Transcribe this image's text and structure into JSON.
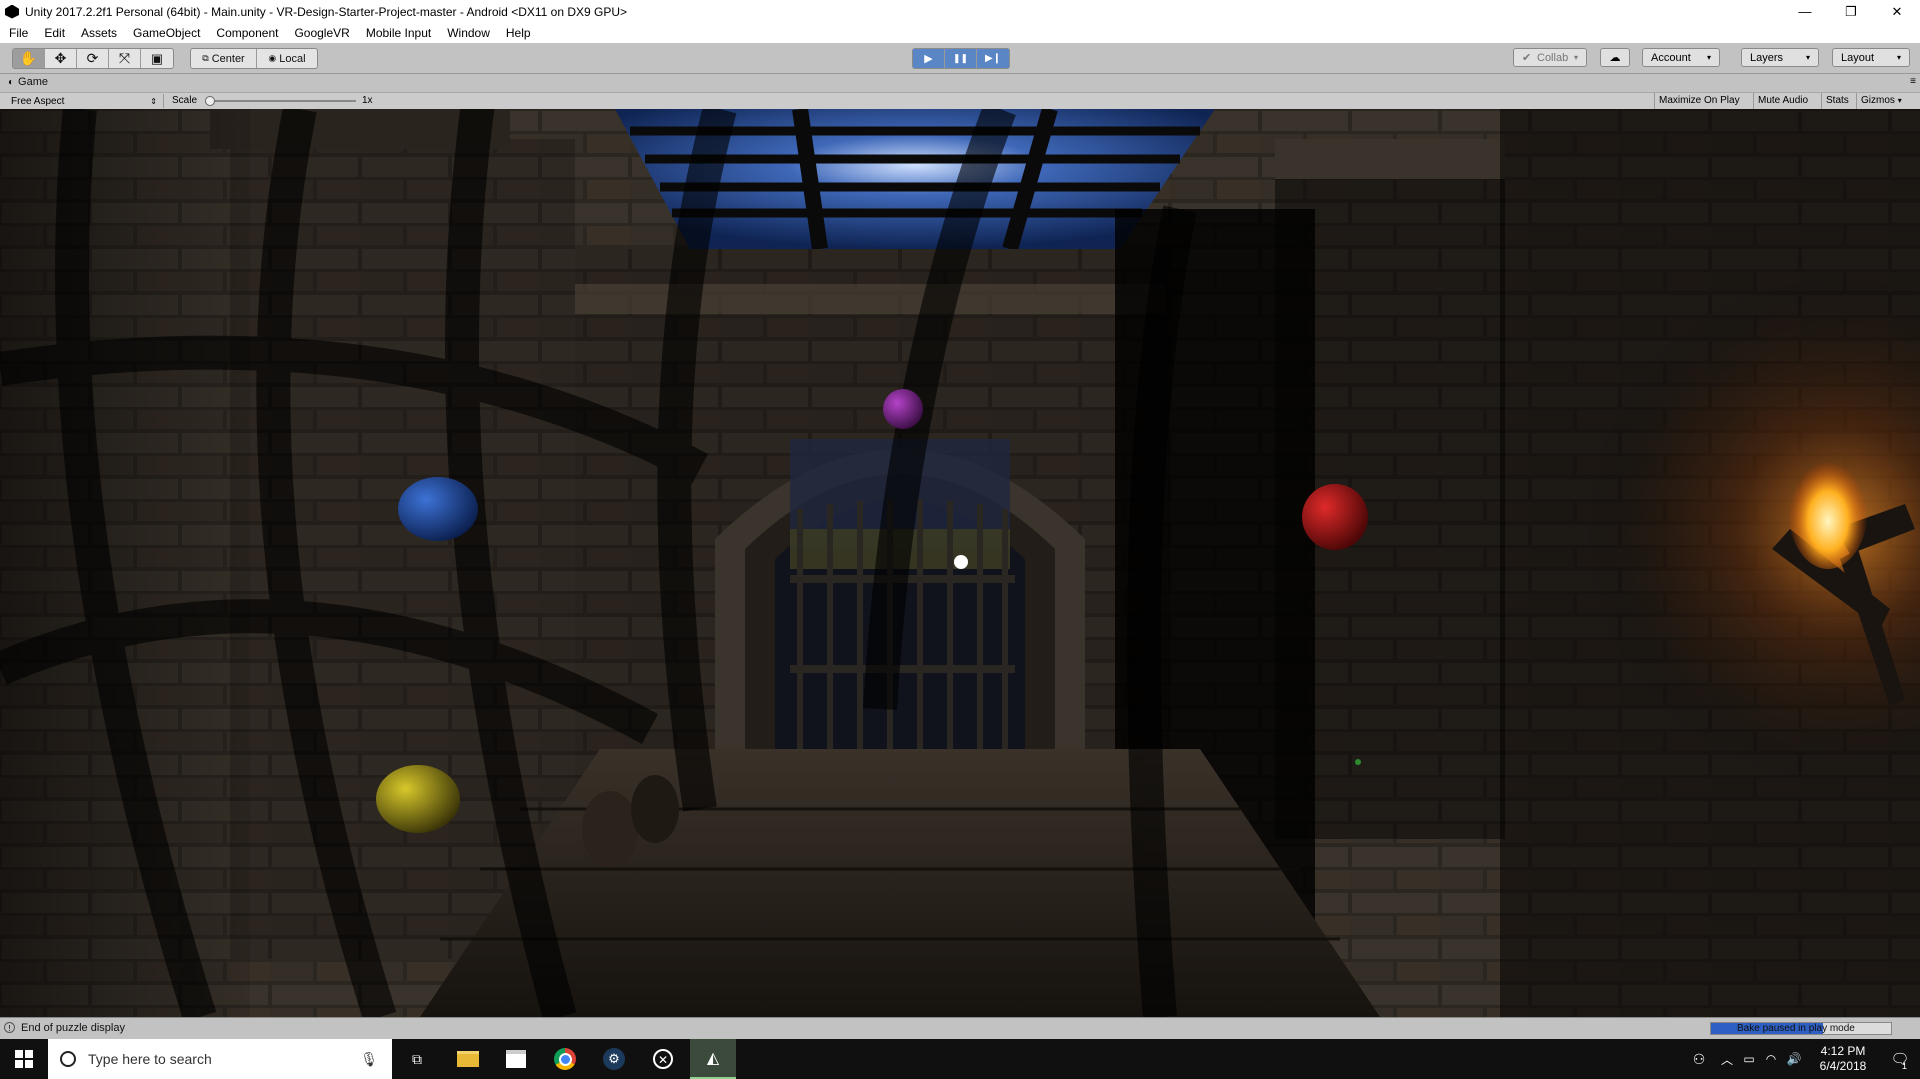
{
  "window": {
    "title": "Unity 2017.2.2f1 Personal (64bit) - Main.unity - VR-Design-Starter-Project-master - Android <DX11 on DX9 GPU>",
    "controls": [
      "—",
      "❐",
      "✕"
    ]
  },
  "menu": [
    "File",
    "Edit",
    "Assets",
    "GameObject",
    "Component",
    "GoogleVR",
    "Mobile Input",
    "Window",
    "Help"
  ],
  "toolbar": {
    "tools": [
      {
        "name": "hand-tool",
        "icon": "✋"
      },
      {
        "name": "move-tool",
        "icon": "✥"
      },
      {
        "name": "rotate-tool",
        "icon": "⟳"
      },
      {
        "name": "scale-tool",
        "icon": "⤧"
      },
      {
        "name": "rect-tool",
        "icon": "▣"
      }
    ],
    "pivot_label": "Center",
    "space_label": "Local",
    "play_icons": [
      "▶",
      "❚❚",
      "▶❙"
    ],
    "collab_label": "Collab",
    "account_label": "Account",
    "layers_label": "Layers",
    "layout_label": "Layout"
  },
  "game_panel": {
    "tab_label": "Game",
    "aspect_label": "Free Aspect",
    "scale_label": "Scale",
    "scale_value": "1x",
    "maximize_label": "Maximize On Play",
    "mute_label": "Mute Audio",
    "stats_label": "Stats",
    "gizmos_label": "Gizmos"
  },
  "status": {
    "message": "End of puzzle display",
    "bake_label": "Bake paused in play mode"
  },
  "taskbar": {
    "search_placeholder": "Type here to search",
    "time": "4:12 PM",
    "date": "6/4/2018",
    "notification_count": "1"
  },
  "colors": {
    "play_active": "#5a86c5",
    "bake_progress": "#2e5fc2",
    "sphere_blue": "#1f4ea8",
    "sphere_red": "#b01515",
    "sphere_purple": "#8a2aa0",
    "sphere_yellow": "#b8a61a"
  }
}
